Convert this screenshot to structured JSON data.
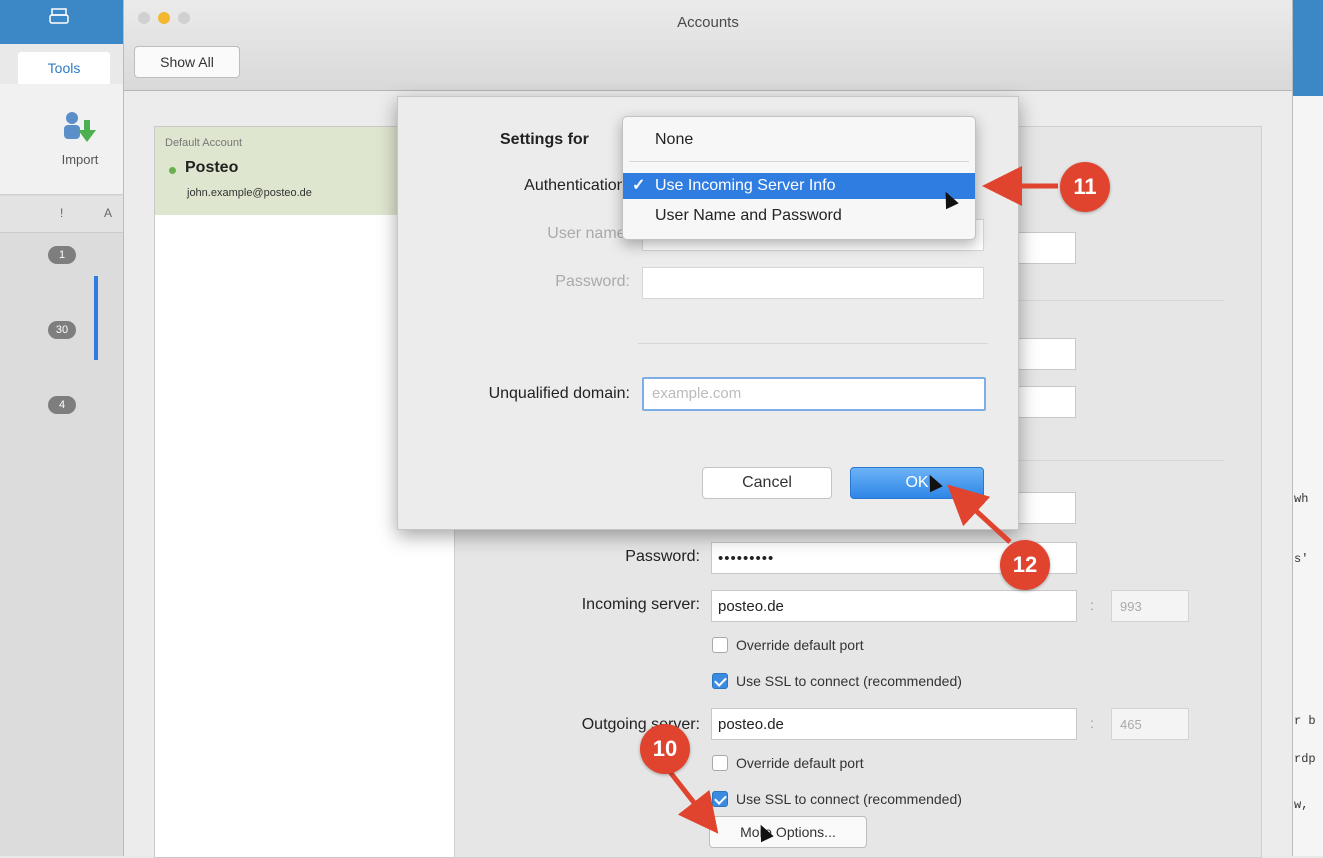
{
  "app": {
    "tabs": [
      "Tools"
    ],
    "ribbon": {
      "import_label": "Import"
    },
    "column_header": [
      "!",
      "A"
    ],
    "unread_counts": [
      "1",
      "30",
      "4"
    ]
  },
  "window": {
    "title": "Accounts",
    "show_all": "Show All"
  },
  "account": {
    "default_label": "Default Account",
    "name": "Posteo",
    "email": "john.example@posteo.de"
  },
  "detail": {
    "password_label": "Password:",
    "password_value": "•••••••••",
    "incoming_label": "Incoming server:",
    "incoming_value": "posteo.de",
    "incoming_port": "993",
    "outgoing_label": "Outgoing server:",
    "outgoing_value": "posteo.de",
    "outgoing_port": "465",
    "override_port": "Override default port",
    "use_ssl": "Use SSL to connect (recommended)",
    "more_options": "More Options..."
  },
  "sheet": {
    "settings_for": "Settings for",
    "authentication_label": "Authentication:",
    "username_label": "User name:",
    "password_label": "Password:",
    "unqualified_domain_label": "Unqualified domain:",
    "domain_placeholder": "example.com",
    "cancel": "Cancel",
    "ok": "OK"
  },
  "auth_menu": {
    "items": [
      {
        "label": "None",
        "checked": false
      },
      {
        "label": "Use Incoming Server Info",
        "checked": true
      },
      {
        "label": "User Name and Password",
        "checked": false
      }
    ]
  },
  "callouts": [
    "10",
    "11",
    "12"
  ],
  "right_fragments": [
    "wh",
    "s'",
    "r b",
    "rdp",
    "w,"
  ],
  "colors": {
    "accent": "#2f7de1",
    "callout": "#e0432e",
    "account_highlight": "#dfe6cf",
    "app_blue": "#3c87c6"
  }
}
